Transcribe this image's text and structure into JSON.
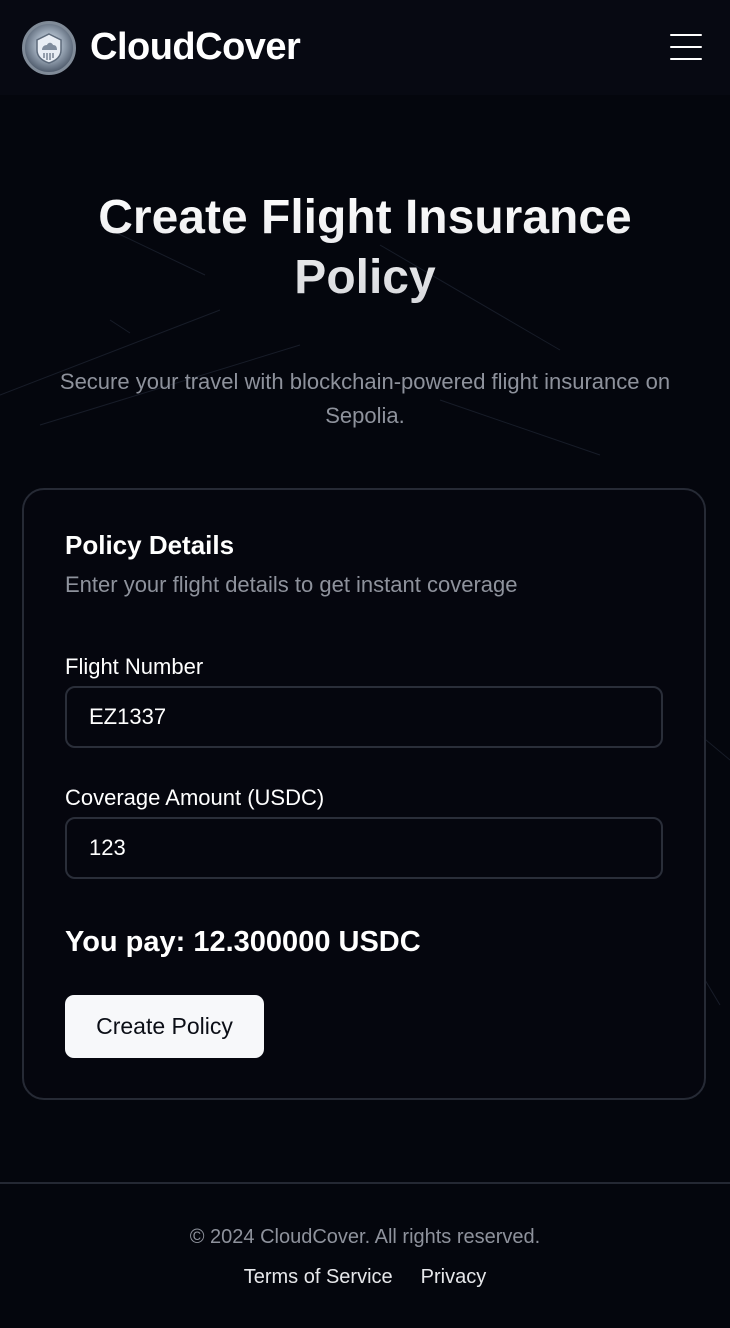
{
  "header": {
    "brand": "CloudCover",
    "logo_icon": "cloud-shield-logo-icon",
    "menu_icon": "hamburger-menu-icon"
  },
  "hero": {
    "title": "Create Flight Insurance Policy",
    "subtitle": "Secure your travel with blockchain-powered flight insurance on Sepolia."
  },
  "policy_card": {
    "title": "Policy Details",
    "description": "Enter your flight details to get instant coverage",
    "flight_number_label": "Flight Number",
    "flight_number_value": "EZ1337",
    "coverage_label": "Coverage Amount (USDC)",
    "coverage_value": "123",
    "pay_text": "You pay: 12.300000 USDC",
    "create_button": "Create Policy"
  },
  "footer": {
    "copyright": "© 2024 CloudCover. All rights reserved.",
    "links": [
      "Terms of Service",
      "Privacy"
    ]
  },
  "colors": {
    "background": "#04060d",
    "header_bg": "#070912",
    "muted_text": "#8e929c",
    "border": "#262a35",
    "button_bg": "#f7f8fa"
  }
}
